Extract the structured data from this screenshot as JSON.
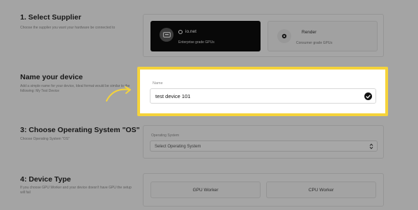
{
  "section1": {
    "title": "1. Select Supplier",
    "desc": "Choose the supplier you want your hardware be connected to",
    "suppliers": [
      {
        "name": "io.net",
        "sub": "Enterprise grade GPUs"
      },
      {
        "name": "Render",
        "sub": "Consumer grade GPUs"
      }
    ]
  },
  "section2": {
    "title": "Name your device",
    "desc": "Add a simple name for your device, Ideal format would be similar to the following: My Test Device",
    "field_label": "Name",
    "field_value": "test device 101"
  },
  "section3": {
    "title": "3: Choose Operating System \"OS\"",
    "desc": "Choose Operating System \"OS\"",
    "field_label": "Operating System",
    "select_value": "Select Operating System"
  },
  "section4": {
    "title": "4: Device Type",
    "desc": "If you choose GPU Worker and your device doesn't have GPU the setup will fail",
    "options": [
      "GPU Worker",
      "CPU Worker"
    ]
  },
  "colors": {
    "highlight": "#f5d33a",
    "arrow": "#f5d33a",
    "dark_card": "#0d0d0d"
  },
  "icons": [
    "io-net-logo-icon",
    "render-logo-icon",
    "check-circle-icon",
    "updown-chevron-icon",
    "arrow-icon"
  ]
}
